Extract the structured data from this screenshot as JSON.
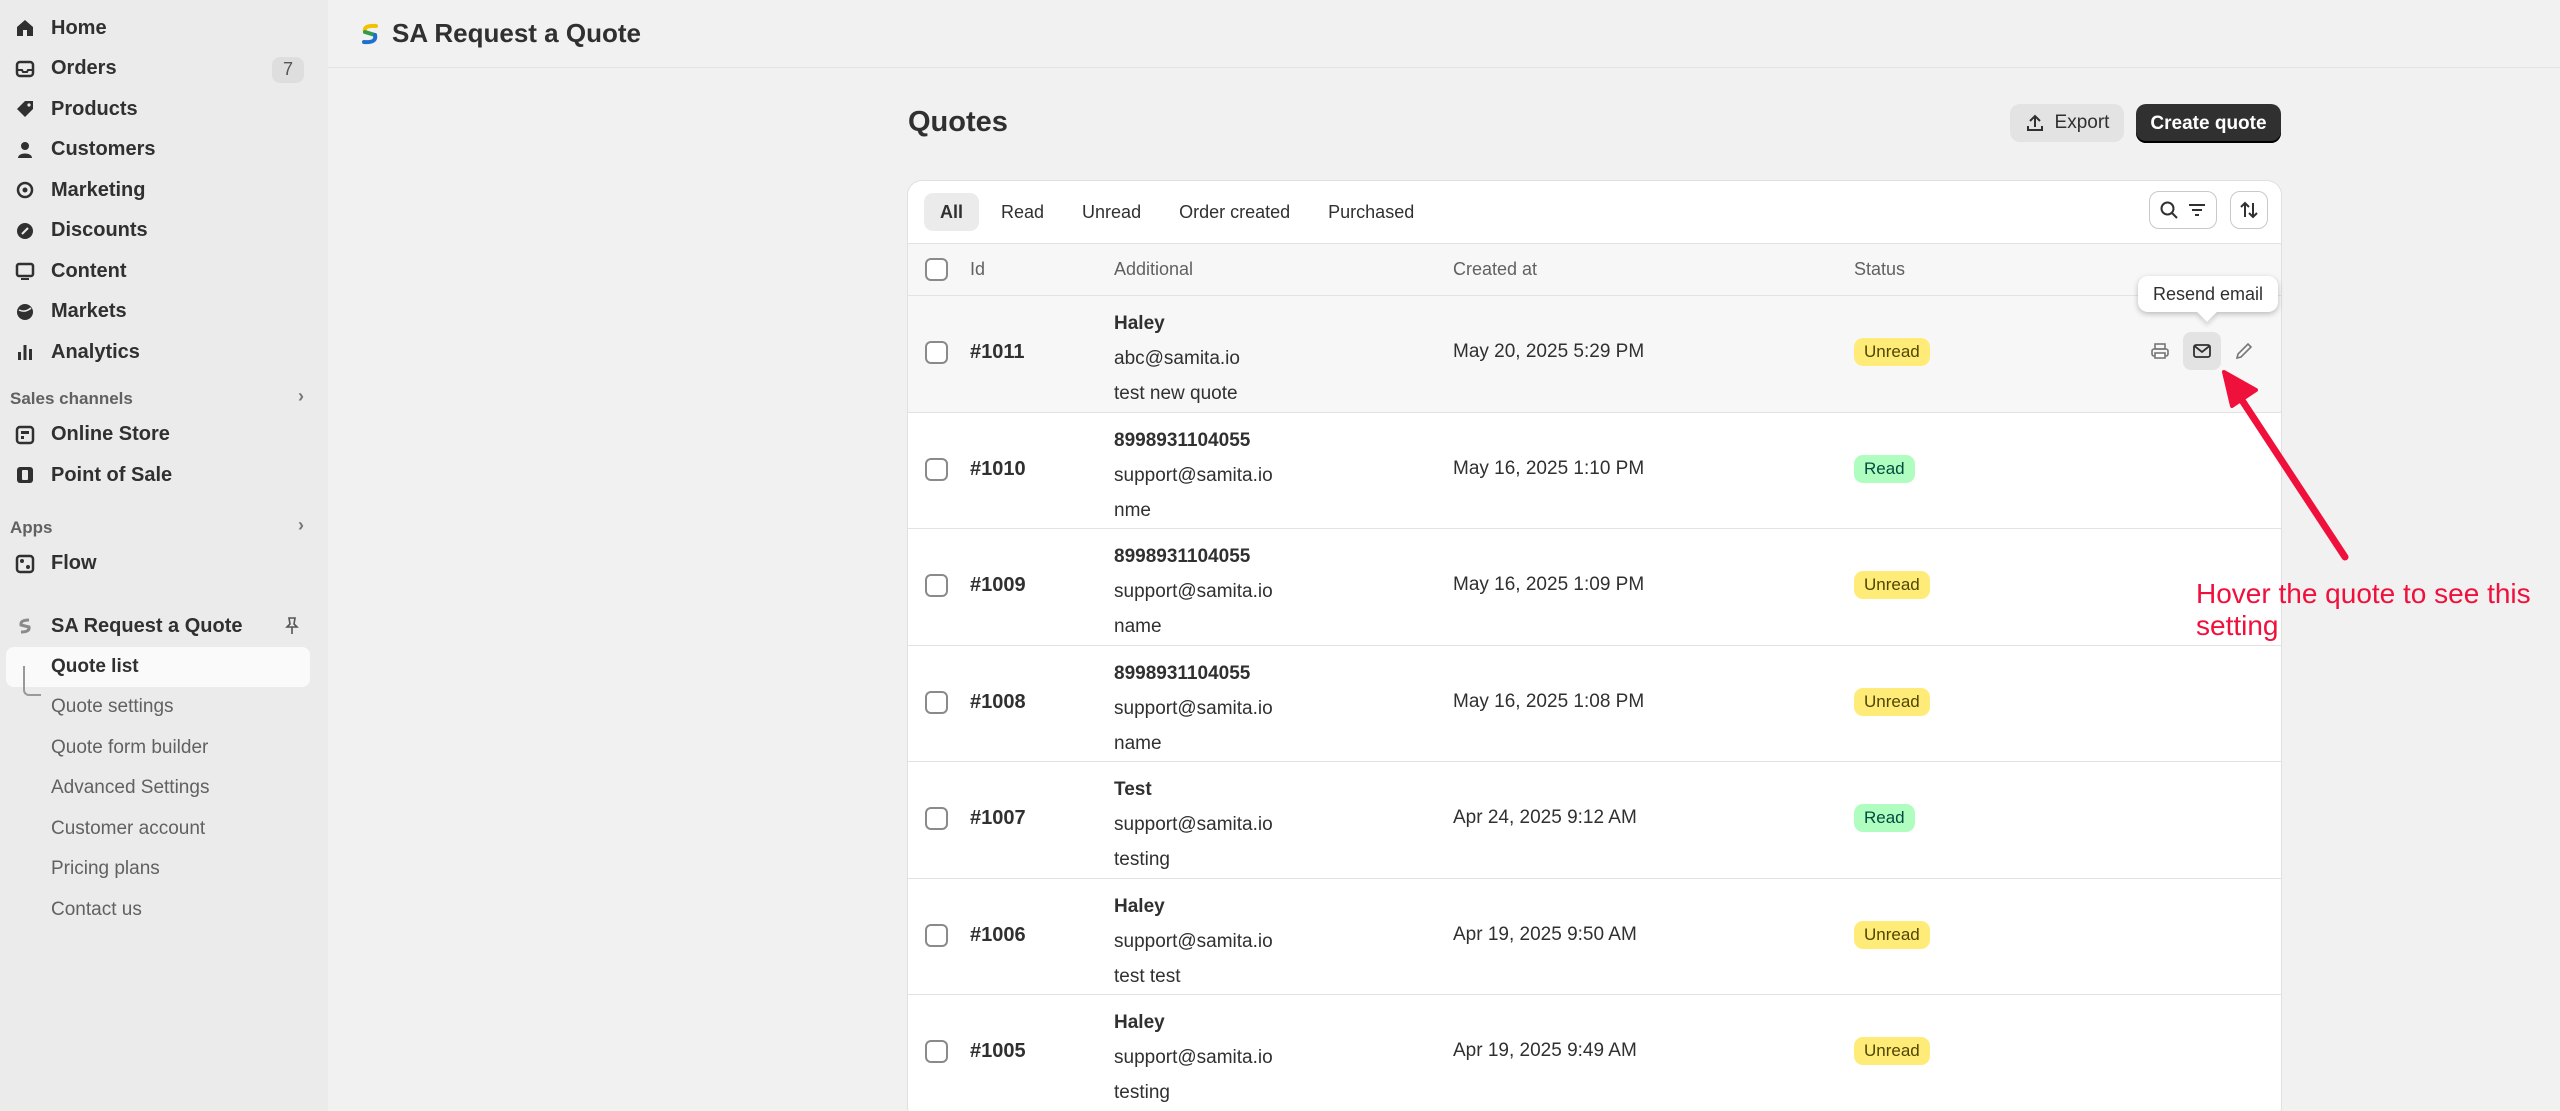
{
  "sidebar": {
    "items": [
      {
        "label": "Home",
        "icon": "home-icon"
      },
      {
        "label": "Orders",
        "icon": "inbox-icon",
        "count": "7"
      },
      {
        "label": "Products",
        "icon": "tag-icon"
      },
      {
        "label": "Customers",
        "icon": "person-icon"
      },
      {
        "label": "Marketing",
        "icon": "target-icon"
      },
      {
        "label": "Discounts",
        "icon": "discount-icon"
      },
      {
        "label": "Content",
        "icon": "content-icon"
      },
      {
        "label": "Markets",
        "icon": "globe-icon"
      },
      {
        "label": "Analytics",
        "icon": "bar-chart-icon"
      }
    ],
    "sales_channels": {
      "heading": "Sales channels",
      "items": [
        {
          "label": "Online Store",
          "icon": "store-icon"
        },
        {
          "label": "Point of Sale",
          "icon": "pos-icon"
        }
      ]
    },
    "apps": {
      "heading": "Apps",
      "items": [
        {
          "label": "Flow",
          "icon": "flow-icon"
        }
      ]
    },
    "pinned_app": {
      "label": "SA Request a Quote",
      "sub_items": [
        "Quote list",
        "Quote settings",
        "Quote form builder",
        "Advanced Settings",
        "Customer account",
        "Pricing plans",
        "Contact us"
      ],
      "active": "Quote list"
    }
  },
  "topbar": {
    "title": "SA Request a Quote"
  },
  "page": {
    "title": "Quotes",
    "export_label": "Export",
    "create_label": "Create quote"
  },
  "tabs": [
    "All",
    "Read",
    "Unread",
    "Order created",
    "Purchased"
  ],
  "table": {
    "columns": [
      "Id",
      "Additional",
      "Created at",
      "Status"
    ],
    "rows": [
      {
        "id": "#1011",
        "name": "Haley",
        "email": "abc@samita.io",
        "note": "test new quote",
        "created": "May 20, 2025 5:29 PM",
        "status": "Unread"
      },
      {
        "id": "#1010",
        "name": "8998931104055",
        "email": "support@samita.io",
        "note": "nme",
        "created": "May 16, 2025 1:10 PM",
        "status": "Read"
      },
      {
        "id": "#1009",
        "name": "8998931104055",
        "email": "support@samita.io",
        "note": "name",
        "created": "May 16, 2025 1:09 PM",
        "status": "Unread"
      },
      {
        "id": "#1008",
        "name": "8998931104055",
        "email": "support@samita.io",
        "note": "name",
        "created": "May 16, 2025 1:08 PM",
        "status": "Unread"
      },
      {
        "id": "#1007",
        "name": "Test",
        "email": "support@samita.io",
        "note": "testing",
        "created": "Apr 24, 2025 9:12 AM",
        "status": "Read"
      },
      {
        "id": "#1006",
        "name": "Haley",
        "email": "support@samita.io",
        "note": "test test",
        "created": "Apr 19, 2025 9:50 AM",
        "status": "Unread"
      },
      {
        "id": "#1005",
        "name": "Haley",
        "email": "support@samita.io",
        "note": "testing",
        "created": "Apr 19, 2025 9:49 AM",
        "status": "Unread"
      }
    ]
  },
  "tooltip": "Resend email",
  "annotation": "Hover the quote to see this setting",
  "colors": {
    "annotation": "#f0103c",
    "unread_badge": "#ffeb78",
    "read_badge": "#affebf",
    "primary_button": "#303030"
  }
}
